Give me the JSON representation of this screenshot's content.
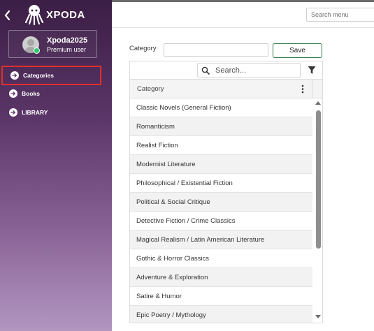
{
  "brand": {
    "name": "XPODA"
  },
  "user": {
    "name": "Xpoda2025",
    "role": "Premium user"
  },
  "sidebar": {
    "items": [
      {
        "label": "Categories",
        "active": true
      },
      {
        "label": "Books",
        "active": false
      },
      {
        "label": "LIBRARY",
        "active": false
      }
    ]
  },
  "topbar": {
    "search_placeholder": "Search menu"
  },
  "form": {
    "category_label": "Category",
    "category_value": "",
    "save_label": "Save"
  },
  "grid": {
    "search_placeholder": "Search...",
    "column_header": "Category",
    "rows": [
      "Classic Novels (General Fiction)",
      "Romanticism",
      "Realist Fiction",
      "Modernist Literature",
      "Philosophical / Existential Fiction",
      "Political & Social Critique",
      "Detective Fiction / Crime Classics",
      "Magical Realism / Latin American Literature",
      "Gothic & Horror Classics",
      "Adventure & Exploration",
      "Satire & Humor",
      "Epic Poetry / Mythology"
    ]
  },
  "colors": {
    "sidebar_top": "#3b1e45",
    "sidebar_bottom": "#b296c0",
    "active_outline": "#e0302a",
    "save_border": "#2e7d4a",
    "status_online": "#2ecc71"
  }
}
